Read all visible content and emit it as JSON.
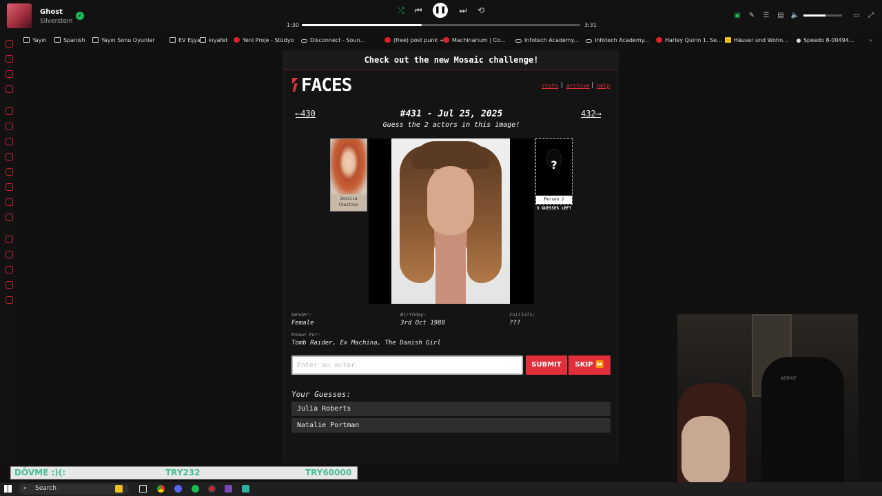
{
  "media": {
    "title": "Ghost",
    "artist": "Silverstein",
    "elapsed": "1:30",
    "total": "3:31",
    "progress": 0.43,
    "volume": 0.58,
    "icons": [
      "shuffle-icon",
      "previous-icon",
      "pause-icon",
      "next-icon",
      "repeat-icon"
    ]
  },
  "bookmarks": [
    {
      "label": "Yayın",
      "icon": "folder"
    },
    {
      "label": "Spanish",
      "icon": "folder"
    },
    {
      "label": "Yayın Sonu Oyunlar",
      "icon": "folder"
    },
    {
      "label": "EV Eşya",
      "icon": "folder"
    },
    {
      "label": "kıyafet",
      "icon": "folder"
    },
    {
      "label": "Yeni Proje - Stüdyo",
      "icon": "red"
    },
    {
      "label": "Disconnect - Soun...",
      "icon": "link"
    },
    {
      "label": "(free) post punk +...",
      "icon": "red"
    },
    {
      "label": "Machinarium | Co...",
      "icon": "red"
    },
    {
      "label": "Infotech Academy...",
      "icon": "link"
    },
    {
      "label": "Infotech Academy...",
      "icon": "link"
    },
    {
      "label": "Harley Quinn 1. Se...",
      "icon": "red"
    },
    {
      "label": "Häuser und Wohn...",
      "icon": "yellow"
    },
    {
      "label": "Speedo 8-00494...",
      "icon": "dot"
    }
  ],
  "page": {
    "banner": "Check out the new Mosaic challenge!",
    "logo": "FACES",
    "links": {
      "stats": "stats",
      "archive": "archive",
      "help": "help",
      "sep": "|"
    },
    "prev": "⟵430",
    "next": "432⟶",
    "title": "#431 - Jul 25, 2025",
    "subtitle": "Guess the 2 actors in this image!",
    "person1_name": "Jessica Chastain",
    "person2_name": "Person 2",
    "person2_mark": "?",
    "guesses_left": "3 GUESSES LEFT",
    "clues": {
      "gender_label": "Gender:",
      "gender": "Female",
      "birthday_label": "Birthday:",
      "birthday": "3rd Oct 1988",
      "initials_label": "Initials:",
      "initials": "???",
      "known_for_label": "Known For:",
      "known_for": "Tomb Raider, Ex Machina, The Danish Girl"
    },
    "input_placeholder": "Enter an actor",
    "submit": "SUBMIT",
    "skip": "SKIP ⏩",
    "guesses_heading": "Your Guesses:",
    "guesses": [
      "Julia Roberts",
      "Natalie Portman"
    ]
  },
  "webcam": {
    "chair_brand": "XDRIVE"
  },
  "chat": {
    "left": "DÖVME :)(:",
    "middle": "TRY232",
    "right": "TRY60000"
  },
  "taskbar": {
    "search": "Search"
  },
  "colors": {
    "accent": "#e2303a",
    "spotify_green": "#1db954"
  }
}
